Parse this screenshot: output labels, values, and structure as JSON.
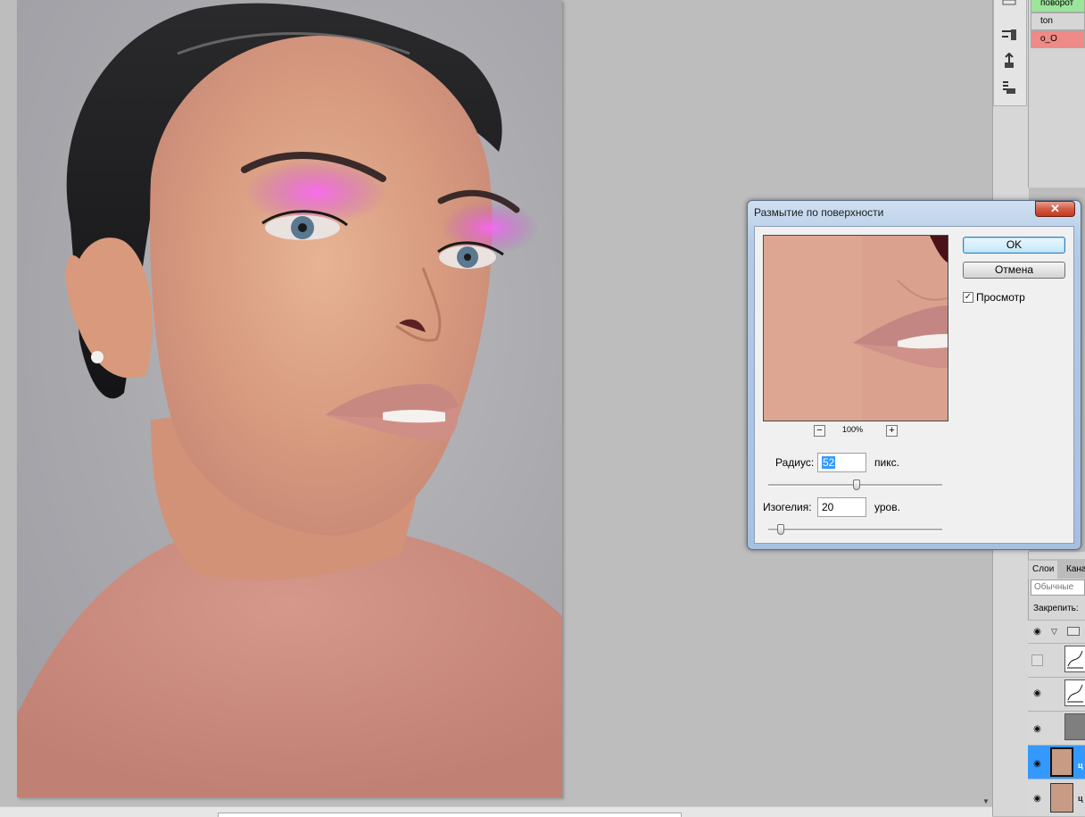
{
  "dialog": {
    "title": "Размытие по поверхности",
    "close_label": "✕",
    "ok_label": "OK",
    "cancel_label": "Отмена",
    "preview_label": "Просмотр",
    "preview_checked": true,
    "zoom_out_label": "−",
    "zoom_in_label": "+",
    "zoom_level": "100%",
    "radius_label": "Радиус:",
    "radius_value": "52",
    "radius_unit": "пикс.",
    "radius_slider_fraction": 0.51,
    "threshold_label": "Изогелия:",
    "threshold_value": "20",
    "threshold_unit": "уров.",
    "threshold_slider_fraction": 0.07
  },
  "actions": {
    "items": [
      {
        "label": "поворот",
        "color": "#9be59b"
      },
      {
        "label": "ton",
        "color": "#d6d6d6"
      },
      {
        "label": "o_O",
        "color": "#ee8a87"
      }
    ]
  },
  "layers": {
    "tab_layers": "Слои",
    "tab_channels": "Кана",
    "blend_mode": "Обычные",
    "lock_label": "Закрепить:",
    "rows": [
      {
        "label": "",
        "visible": true,
        "selected": false,
        "kind": "group"
      },
      {
        "label": "",
        "visible": false,
        "selected": false,
        "kind": "curves"
      },
      {
        "label": "",
        "visible": true,
        "selected": false,
        "kind": "curves"
      },
      {
        "label": "",
        "visible": true,
        "selected": false,
        "kind": "gray"
      },
      {
        "label": "ц",
        "visible": true,
        "selected": true,
        "kind": "photo"
      },
      {
        "label": "ц",
        "visible": true,
        "selected": false,
        "kind": "photo"
      }
    ]
  },
  "tools": {
    "icons": [
      "brush-presets-icon",
      "clone-source-icon",
      "tool-presets-icon"
    ]
  },
  "colors": {
    "selection_blue": "#3399ff",
    "dialog_frame": "#a6c0e0",
    "close_red": "#c23a1f"
  }
}
